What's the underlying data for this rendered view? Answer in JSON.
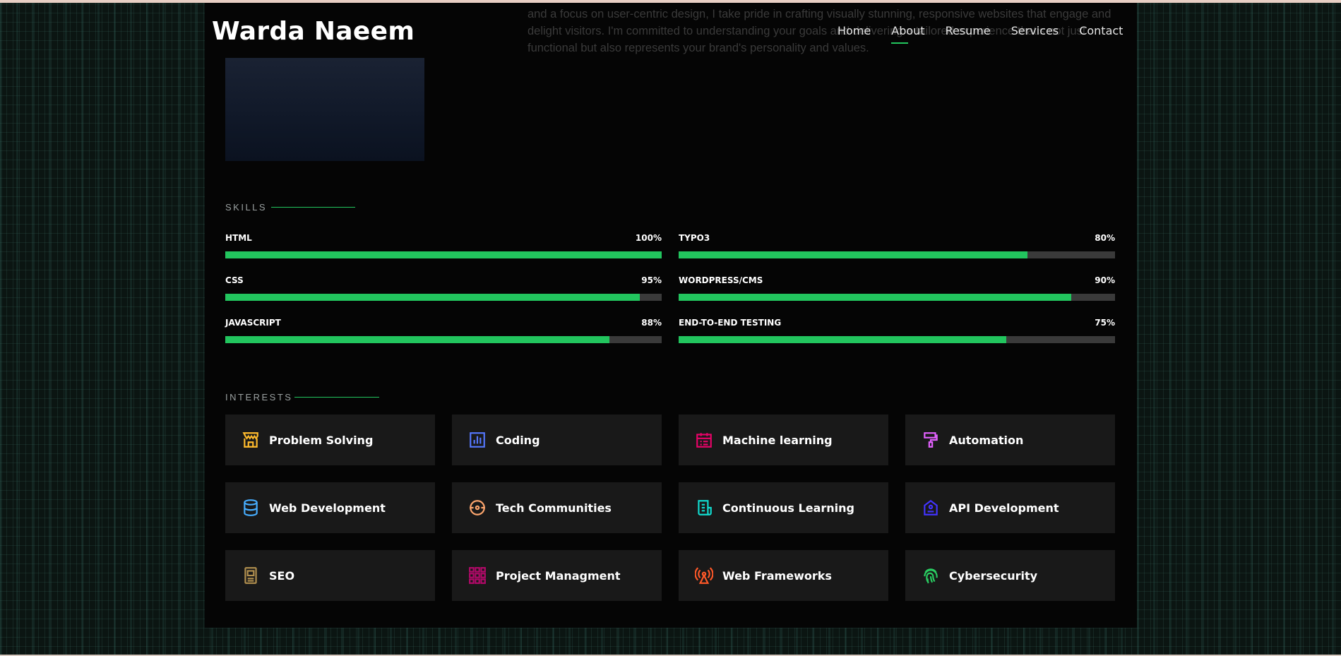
{
  "header": {
    "logo": "Warda Naeem",
    "nav": [
      {
        "label": "Home",
        "active": false
      },
      {
        "label": "About",
        "active": true
      },
      {
        "label": "Resume",
        "active": false
      },
      {
        "label": "Services",
        "active": false
      },
      {
        "label": "Contact",
        "active": false
      }
    ]
  },
  "intro": {
    "text": "and a focus on user-centric design, I take pride in crafting visually stunning, responsive websites that engage and delight visitors. I'm committed to understanding your goals and delivering a tailored experience that's not just functional but also represents your brand's personality and values."
  },
  "skills": {
    "title": "SKILLS",
    "items": [
      {
        "name": "HTML",
        "pct": "100%",
        "value": 100
      },
      {
        "name": "TYPO3",
        "pct": "80%",
        "value": 80
      },
      {
        "name": "CSS",
        "pct": "95%",
        "value": 95
      },
      {
        "name": "WORDPRESS/CMS",
        "pct": "90%",
        "value": 90
      },
      {
        "name": "JAVASCRIPT",
        "pct": "88%",
        "value": 88
      },
      {
        "name": "END-TO-END TESTING",
        "pct": "75%",
        "value": 75
      }
    ]
  },
  "interests": {
    "title": "INTERESTS",
    "items": [
      {
        "label": "Problem Solving",
        "icon": "store-icon",
        "color": "#ffbb2c"
      },
      {
        "label": "Coding",
        "icon": "bar-chart-icon",
        "color": "#5578ff"
      },
      {
        "label": "Machine learning",
        "icon": "calendar-todo-icon",
        "color": "#e80368"
      },
      {
        "label": "Automation",
        "icon": "paint-brush-icon",
        "color": "#e361ff"
      },
      {
        "label": "Web Development",
        "icon": "database-icon",
        "color": "#47aeff"
      },
      {
        "label": "Tech Communities",
        "icon": "gradienter-icon",
        "color": "#ffa76e"
      },
      {
        "label": "Continuous Learning",
        "icon": "file-list-icon",
        "color": "#11dbcf"
      },
      {
        "label": "API Development",
        "icon": "price-tag-icon",
        "color": "#4233ff"
      },
      {
        "label": "SEO",
        "icon": "disc-icon",
        "color": "#b2904f"
      },
      {
        "label": "Project Managment",
        "icon": "base-station-icon",
        "color": "#b20969"
      },
      {
        "label": "Web Frameworks",
        "icon": "fingerprint-icon",
        "color": "#ff5828"
      },
      {
        "label": "Cybersecurity",
        "icon": "fingerprint-icon",
        "color": "#29cc61"
      }
    ]
  }
}
